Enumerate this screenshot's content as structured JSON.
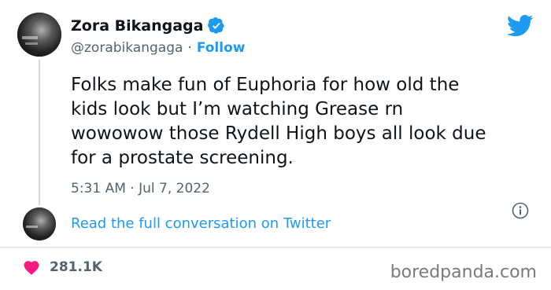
{
  "author": {
    "name": "Zora Bikangaga",
    "handle": "@zorabikangaga",
    "separator": "·",
    "follow_label": "Follow"
  },
  "tweet": {
    "lines": [
      "Folks make fun of Euphoria for how old the",
      "kids look but I’m watching Grease rn",
      "wowowow those Rydell High boys all look due",
      "for a prostate screening."
    ],
    "timestamp": "5:31 AM · Jul 7, 2022"
  },
  "conversation_link": "Read the full conversation on Twitter",
  "likes": "281.1K",
  "watermark": "boredpanda.com",
  "icons": {
    "verified": "verified-badge-icon",
    "twitter": "twitter-bird-icon",
    "info": "info-icon",
    "heart": "heart-icon"
  },
  "colors": {
    "accent": "#1d9bf0",
    "heart": "#f91880",
    "text": "#0f1419",
    "muted": "#536471"
  }
}
